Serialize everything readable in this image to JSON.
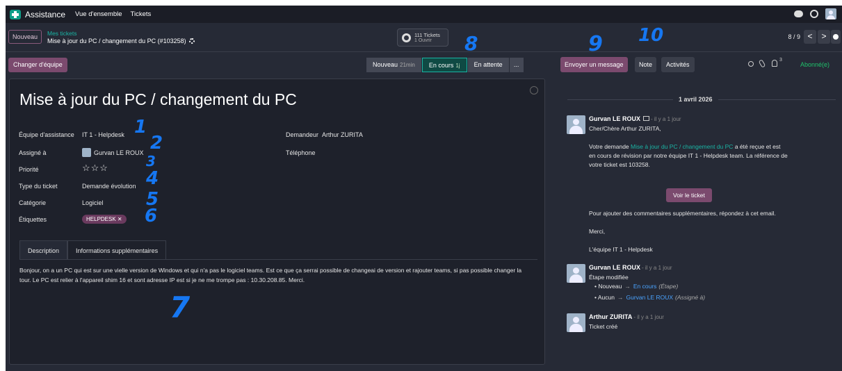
{
  "app": {
    "name": "Assistance",
    "nav": [
      "Vue d'ensemble",
      "Tickets"
    ]
  },
  "breadcrumb": {
    "new_button": "Nouveau",
    "parent": "Mes tickets",
    "current": "Mise à jour du PC / changement du PC (#103258)"
  },
  "tickets_widget": {
    "count": "111 Tickets",
    "open": "1 Ouvrir"
  },
  "pager": {
    "value": "8 / 9",
    "prev": "<",
    "next": ">"
  },
  "annotations": [
    "1",
    "2",
    "3",
    "4",
    "5",
    "6",
    "7",
    "8",
    "9",
    "10"
  ],
  "actions": {
    "change_team": "Changer d'équipe"
  },
  "stages": [
    {
      "label": "Nouveau",
      "duration": "21min"
    },
    {
      "label": "En cours",
      "duration": "1j"
    },
    {
      "label": "En attente",
      "duration": ""
    },
    {
      "label": "...",
      "duration": ""
    }
  ],
  "ticket": {
    "title": "Mise à jour du PC / changement du PC",
    "fields": {
      "team_label": "Équipe d'assistance",
      "team_value": "IT 1 - Helpdesk",
      "assigned_label": "Assigné à",
      "assigned_value": "Gurvan LE ROUX",
      "priority_label": "Priorité",
      "priority_value": "☆☆☆",
      "type_label": "Type du ticket",
      "type_value": "Demande évolution",
      "category_label": "Catégorie",
      "category_value": "Logiciel",
      "tags_label": "Étiquettes",
      "tag_value": "HELPDESK ✕",
      "requester_label": "Demandeur",
      "requester_value": "Arthur ZURITA",
      "phone_label": "Téléphone"
    },
    "tabs": [
      "Description",
      "Informations supplémentaires"
    ],
    "description": "Bonjour, on a un PC qui est sur une vielle version de Windows et qui n'a pas le logiciel teams. Est ce que ça serrai possible de changeai de version et rajouter teams, si pas possible changer la tour. Le PC est relier à l'appareil shim 16 et sont adresse IP est si je ne me trompe pas : 10.30.208.85. Merci."
  },
  "chatter": {
    "send_message": "Envoyer un message",
    "note": "Note",
    "activities": "Activités",
    "followers_count": "3",
    "subscribed": "Abonné(e)",
    "date": "1 avril 2026",
    "messages": [
      {
        "author": "Gurvan LE ROUX",
        "time": "- il y a 1 jour",
        "greeting": "Cher/Chère Arthur ZURITA,",
        "body_prefix": "Votre demande",
        "body_link": "Mise à jour du PC / changement du PC",
        "body_line1_rest": "a été reçue et est",
        "body_line2": "en cours de révision par notre équipe IT 1 - Helpdesk team. La référence de",
        "body_line3": "votre ticket est 103258.",
        "button": "Voir le ticket",
        "after_button": "Pour ajouter des commentaires supplémentaires, répondez à cet email.",
        "thanks": "Merci,",
        "signature": "L'équipe IT 1 - Helpdesk"
      },
      {
        "author": "Gurvan LE ROUX",
        "time": "- il y a 1 jour",
        "subtitle": "Étape modifiée",
        "changes": [
          {
            "old": "Nouveau",
            "new": "En cours",
            "field": "(Étape)"
          },
          {
            "old": "Aucun",
            "new": "Gurvan LE ROUX",
            "field": "(Assigné à)"
          }
        ]
      },
      {
        "author": "Arthur ZURITA",
        "time": "- il y a 1 jour",
        "subtitle": "Ticket créé"
      }
    ]
  }
}
